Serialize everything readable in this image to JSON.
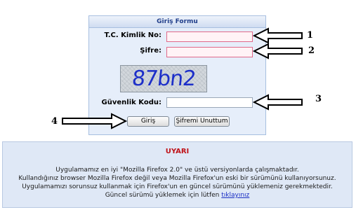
{
  "login_form": {
    "title": "Giriş Formu",
    "tc_label": "T.C. Kimlik No:",
    "password_label": "Şifre:",
    "captcha_text": "87bn2",
    "security_code_label": "Güvenlik Kodu:",
    "login_button": "Giriş",
    "forgot_button": "Şifremi Unuttum"
  },
  "annotations": {
    "n1": "1",
    "n2": "2",
    "n3": "3",
    "n4": "4"
  },
  "warning": {
    "title": "UYARI",
    "line1": "Uygulamamız en iyi \"Mozilla Firefox 2.0\" ve üstü versiyonlarda çalışmaktadır.",
    "line2": "Kullandığınız browser Mozilla Firefox değil veya Mozilla Firefox'un eski bir sürümünü kullanıyorsunuz.",
    "line3": "Uygulamamızı sorunsuz kullanmak için Firefox'un en güncel sürümünü yüklemeniz gerekmektedir.",
    "line4_prefix": "Güncel sürümü yüklemek için lütfen",
    "line4_link": "tıklayınız"
  },
  "colors": {
    "header_text": "#1f3d8a",
    "warning_title": "#c0141a",
    "link": "#1b2fc4",
    "captcha_text": "#1d2fc9"
  }
}
